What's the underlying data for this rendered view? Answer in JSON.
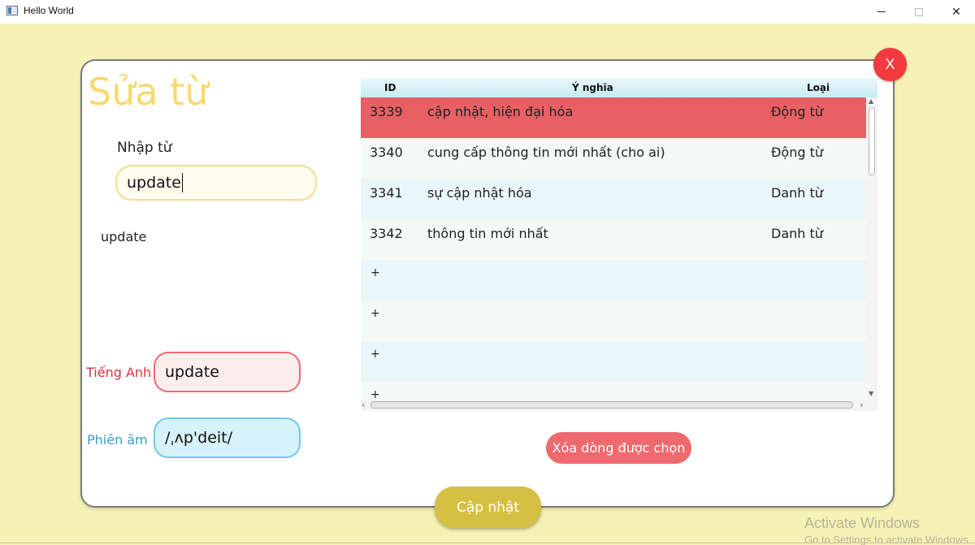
{
  "window": {
    "title": "Hello World",
    "close_glyph": "✕"
  },
  "dialog": {
    "close_label": "X",
    "title": "Sửa từ",
    "word_label": "Nhập từ",
    "word_value": "update",
    "word_echo": "update",
    "english_label": "Tiếng Anh",
    "english_value": "update",
    "phonetic_label": "Phiên âm",
    "phonetic_value": "/ˌʌp'deit/",
    "delete_label": "Xóa dòng được chọn",
    "update_label": "Cập nhật"
  },
  "table": {
    "headers": {
      "id": "ID",
      "meaning": "Ý nghĩa",
      "type": "Loại"
    },
    "rows": [
      {
        "id": "3339",
        "meaning": "cập nhật, hiện đại hóa",
        "type": "Động từ",
        "selected": true
      },
      {
        "id": "3340",
        "meaning": "cung cấp thông tin mới nhất (cho ai)",
        "type": "Động từ"
      },
      {
        "id": "3341",
        "meaning": "sự cập nhật hóa",
        "type": "Danh từ"
      },
      {
        "id": "3342",
        "meaning": "thông tin mới nhất",
        "type": "Danh từ"
      }
    ],
    "add_row_glyph": "+",
    "add_rows": [
      "+",
      "+",
      "+",
      "+"
    ]
  },
  "watermark": {
    "title": "Activate Windows",
    "subtitle": "Go to Settings to activate Windows."
  },
  "colors": {
    "background": "#f6f2b5",
    "selected_row": "#e86064",
    "close_button": "#f23a3f",
    "delete_button": "#ee6a6f",
    "update_button": "#d6c043",
    "title": "#f7da6e"
  }
}
